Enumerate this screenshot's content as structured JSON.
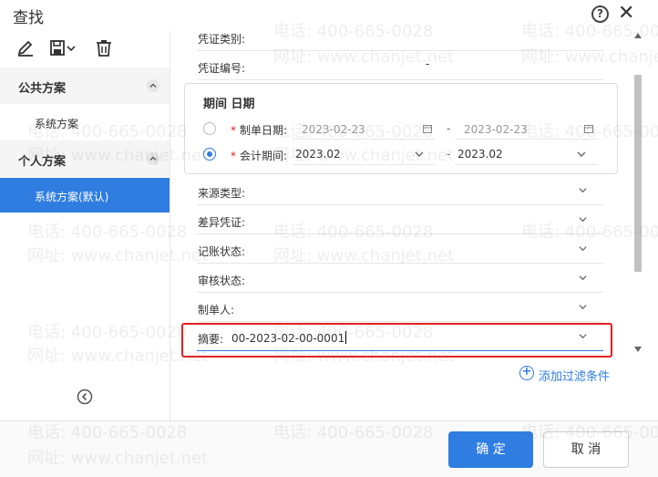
{
  "window": {
    "title": "查找",
    "help_symbol": "?",
    "close_symbol": "✕"
  },
  "toolbar": {
    "edit_icon": "pencil-icon",
    "save_icon": "save-icon",
    "delete_icon": "trash-icon"
  },
  "sidebar": {
    "public_section": "公共方案",
    "public_items": [
      "系统方案"
    ],
    "personal_section": "个人方案",
    "personal_items": [
      "系统方案(默认)"
    ]
  },
  "filters": {
    "voucher_type": {
      "label": "凭证类别:",
      "value": ""
    },
    "voucher_no": {
      "label": "凭证编号:",
      "separator": "-"
    },
    "period_box": {
      "title": "期间 日期",
      "date_label": "制单日期:",
      "date_from": "2023-02-23",
      "date_to": "2023-02-23",
      "period_label": "会计期间:",
      "period_from": "2023.02",
      "period_to": "2023.02",
      "separator": "-",
      "required_mark": "*"
    },
    "source_type": {
      "label": "来源类型:",
      "value": ""
    },
    "diff_voucher": {
      "label": "差异凭证:",
      "value": ""
    },
    "post_status": {
      "label": "记账状态:",
      "value": ""
    },
    "audit_status": {
      "label": "审核状态:",
      "value": ""
    },
    "preparer": {
      "label": "制单人:",
      "value": ""
    },
    "summary": {
      "label": "摘要:",
      "value": "00-2023-02-00-0001"
    }
  },
  "add_filter_label": "添加过滤条件",
  "buttons": {
    "ok": "确 定",
    "cancel": "取 消"
  },
  "watermark": {
    "phone": "电话: 400-665-0028",
    "site": "网址: www.chanjet.net"
  },
  "colors": {
    "accent": "#2f7de1",
    "highlight_border": "#e02020",
    "required": "#e2231a"
  }
}
